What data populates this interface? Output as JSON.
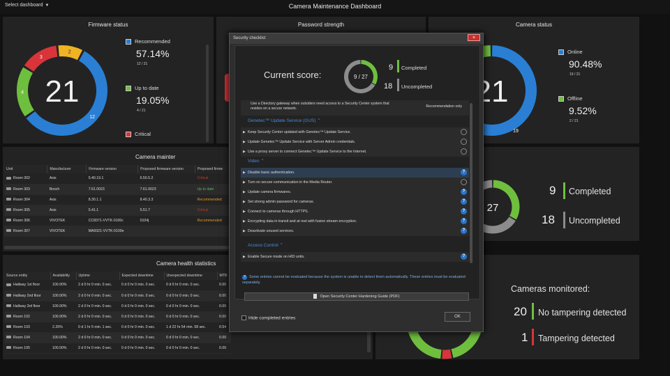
{
  "topbar": {
    "select_dashboard": "Select dashboard",
    "title": "Camera Maintenance Dashboard"
  },
  "firmware": {
    "title": "Firmware status",
    "donut_center": "21",
    "segments": [
      {
        "value": 12,
        "label": "12",
        "color": "#2a7fd4"
      },
      {
        "value": 4,
        "label": "4",
        "color": "#6fbf3f"
      },
      {
        "value": 3,
        "label": "3",
        "color": "#d9343a"
      },
      {
        "value": 2,
        "label": "2",
        "color": "#f0b323"
      }
    ],
    "legend": [
      {
        "label": "Recommended",
        "percent": "57.14%",
        "ratio": "12 / 21",
        "color": "#2a7fd4"
      },
      {
        "label": "Up to date",
        "percent": "19.05%",
        "ratio": "4 / 21",
        "color": "#6fbf3f"
      },
      {
        "label": "Critical",
        "color": "#d9343a"
      }
    ]
  },
  "password": {
    "title": "Password strength"
  },
  "camera_status": {
    "title": "Camera status",
    "donut_center": "21",
    "segment_label": "19",
    "online_value": 19,
    "offline_value": 2,
    "legend": [
      {
        "label": "Online",
        "percent": "90.48%",
        "ratio": "19 / 21",
        "color": "#2a7fd4"
      },
      {
        "label": "Offline",
        "percent": "9.52%",
        "ratio": "2 / 21",
        "color": "#6fbf3f"
      }
    ]
  },
  "maintenance": {
    "title": "Camera mainter",
    "columns": [
      "Unit",
      "Manufacturer",
      "Firmware version",
      "Proposed firmware version",
      "Proposed firmw"
    ],
    "rows": [
      [
        "Room 302",
        "Axis",
        "5.40.19.1",
        "6.50.5.2",
        "Critical"
      ],
      [
        "Room 303",
        "Bosch",
        "7.61.0023",
        "7.61.0023",
        "Up to date"
      ],
      [
        "Room 304",
        "Axis",
        "8.30.1.1",
        "8.40.3.3",
        "Recommended"
      ],
      [
        "Room 305",
        "Axis",
        "5.41.1",
        "5.51.7",
        "Critical"
      ],
      [
        "Room 306",
        "VIVOTEK",
        "CC8371-VVTK-0100c",
        "0104j",
        "Recommended"
      ],
      [
        "Room 307",
        "VIVOTEK",
        "MA9321-VVTK-0100e",
        "",
        ""
      ]
    ]
  },
  "health": {
    "title": "Camera health statistics",
    "columns": [
      "Source entity",
      "Availability",
      "Uptime",
      "Expected downtime",
      "Unexpected downtime",
      "MTB"
    ],
    "rows": [
      [
        "Hallway 1st floor",
        "100.00%",
        "2 d 0 hr 0 min. 0 sec.",
        "0 d 0 hr 0 min. 0 sec.",
        "0 d 0 hr 0 min. 0 sec.",
        "0.00"
      ],
      [
        "Hallway 2nd floor",
        "100.00%",
        "2 d 0 hr 0 min. 0 sec.",
        "0 d 0 hr 0 min. 0 sec.",
        "0 d 0 hr 0 min. 0 sec.",
        "0.00"
      ],
      [
        "Hallway 3rd floor",
        "100.00%",
        "2 d 0 hr 0 min. 0 sec.",
        "0 d 0 hr 0 min. 0 sec.",
        "0 d 0 hr 0 min. 0 sec.",
        "0.00"
      ],
      [
        "Room 102",
        "100.00%",
        "2 d 0 hr 0 min. 0 sec.",
        "0 d 0 hr 0 min. 0 sec.",
        "0 d 0 hr 0 min. 0 sec.",
        "0.00"
      ],
      [
        "Room 103",
        "2.26%",
        "0 d 1 hr 5 min. 1 sec.",
        "0 d 0 hr 0 min. 0 sec.",
        "1 d 22 hr 54 min. 58 sec.",
        "0.54"
      ],
      [
        "Room 104",
        "100.00%",
        "2 d 0 hr 0 min. 0 sec.",
        "0 d 0 hr 0 min. 0 sec.",
        "0 d 0 hr 0 min. 0 sec.",
        "0.00"
      ],
      [
        "Room 105",
        "100.00%",
        "2 d 0 hr 0 min. 0 sec.",
        "0 d 0 hr 0 min. 0 sec.",
        "0 d 0 hr 0 min. 0 sec.",
        "0.00"
      ]
    ]
  },
  "hardening": {
    "center": "27",
    "completed_value": 9,
    "uncompleted_value": 18,
    "completed_num": "9",
    "completed_label": "Completed",
    "uncompleted_num": "18",
    "uncompleted_label": "Uncompleted"
  },
  "tampering": {
    "title": "Cameras monitored:",
    "ok_num": "20",
    "ok_label": "No tampering detected",
    "bad_num": "1",
    "bad_label": "Tampering detected"
  },
  "checklist": {
    "title": "Security checklist",
    "close": "×",
    "score_label": "Current score:",
    "score_center": "9 / 27",
    "completed_value": 9,
    "total_value": 27,
    "completed_num": "9",
    "completed_label": "Completed",
    "uncompleted_num": "18",
    "uncompleted_label": "Uncompleted",
    "top_rule": "Use a Directory gateway when outsiders need access to a Security Center system that resides on a secure network.",
    "top_rule_tag": "Recommendation only",
    "sections": [
      {
        "title": "Genetec™ Update Service (GUS)",
        "rules": [
          "Keep Security Center updated with Genetec™ Update Service.",
          "Update Genetec™ Update Service with Server Admin credentials.",
          "Use a proxy server to connect Genetec™ Update Service to the Internet."
        ]
      },
      {
        "title": "Video",
        "rules": [
          "Disable basic authentication.",
          "Turn on secure communication in the Media Router.",
          "Update camera firmwares.",
          "Set strong admin password for cameras.",
          "Connect to cameras through HTTPS.",
          "Encrypting data in transit and at rest with fusion stream encryption.",
          "Deactivate unused services."
        ]
      },
      {
        "title": "Access Control",
        "rules": [
          "Enable Secure mode on HID units."
        ]
      }
    ],
    "note": "Some entries cannot be evaluated because the system is unable to detect them automatically. These entries must be evaluated separately.",
    "guide_button": "Open Security Center Hardening Guide (PDF)",
    "hide_completed": "Hide completed entries",
    "ok": "OK",
    "colors": {
      "accent": "#4a8cd8",
      "completed": "#6fbf3f",
      "uncompleted": "#8c8c8c"
    }
  }
}
